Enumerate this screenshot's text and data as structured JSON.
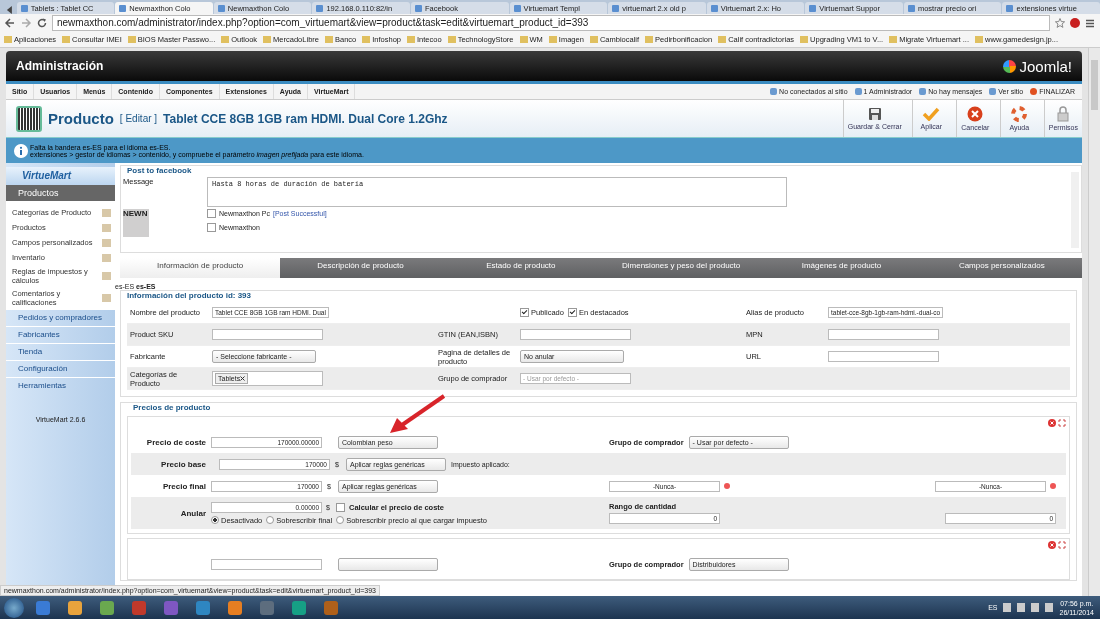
{
  "browser": {
    "tabs": [
      {
        "title": "Tablets : Tablet CC",
        "selected": false
      },
      {
        "title": "Newmaxthon Colo",
        "selected": true
      },
      {
        "title": "Newmaxthon Colo",
        "selected": false
      },
      {
        "title": "192.168.0.110:82/in",
        "selected": false
      },
      {
        "title": "Facebook",
        "selected": false
      },
      {
        "title": "Virtuemart Templ",
        "selected": false
      },
      {
        "title": "virtuemart 2.x old p",
        "selected": false
      },
      {
        "title": "Virtuemart 2.x: Ho",
        "selected": false
      },
      {
        "title": "Virtuemart Suppor",
        "selected": false
      },
      {
        "title": "mostrar precio ori",
        "selected": false
      },
      {
        "title": "extensiones virtue",
        "selected": false
      }
    ],
    "url": "newmaxthon.com/administrator/index.php?option=com_virtuemart&view=product&task=edit&virtuemart_product_id=393",
    "bookmarks": [
      "Aplicaciones",
      "Consultar IMEI",
      "BIOS Master Passwo...",
      "Outlook",
      "MercadoLibre",
      "Banco",
      "Infoshop",
      "Intecoo",
      "TechnologyStore",
      "WM",
      "Imagen",
      "Cambiocalif",
      "Pedirbonificacion",
      "Calif contradictorias",
      "Upgrading VM1 to V...",
      "Migrate Virtuemart ...",
      "www.gamedesign.jp..."
    ]
  },
  "header": {
    "title": "Administración",
    "logo": "Joomla!"
  },
  "menu": {
    "items": [
      "Sitio",
      "Usuarios",
      "Menús",
      "Contenido",
      "Componentes",
      "Extensiones",
      "Ayuda",
      "VirtueMart"
    ],
    "status": [
      "No conectados al sitio",
      "1 Administrador",
      "No hay mensajes",
      "Ver sitio",
      "FINALIZAR"
    ]
  },
  "toolbar": {
    "title": "Producto",
    "edit": "[ Editar ]",
    "product": "Tablet CCE 8GB 1GB ram HDMI. Dual Core 1.2Ghz",
    "buttons": [
      {
        "label": "Guardar & Cerrar",
        "kind": "save"
      },
      {
        "label": "Aplicar",
        "kind": "apply"
      },
      {
        "label": "Cancelar",
        "kind": "cancel"
      },
      {
        "label": "Ayuda",
        "kind": "help"
      },
      {
        "label": "Permisos",
        "kind": "lock"
      }
    ]
  },
  "message": [
    "Falta la bandera es-ES para el idioma es-ES.",
    "extensiones > gestor de idiomas > contenido, y compruebe el parámetro *imagen prefijada* para este idioma."
  ],
  "sidebar": {
    "logo": "VirtueMart",
    "section": "Productos",
    "items": [
      "Categorías de Producto",
      "Productos",
      "Campos personalizados",
      "Inventario",
      "Reglas de impuestos y cálculos",
      "Comentarios y calificaciones"
    ],
    "groups": [
      "Pedidos y compradores",
      "Fabricantes",
      "Tienda",
      "Configuración",
      "Herramientas"
    ],
    "version": "VirtueMart 2.6.6"
  },
  "facebook": {
    "legend": "Post to facebook",
    "label": "Message",
    "message": "Hasta 8 horas de duración de batería",
    "thumb": "NEWN",
    "pages": [
      {
        "name": "Newmaxthon Pc",
        "status": "[Post Successful]",
        "checked": false
      },
      {
        "name": "Newmaxthon",
        "checked": false
      }
    ]
  },
  "tabs": [
    {
      "label": "Información de producto",
      "selected": true
    },
    {
      "label": "Descripción de producto",
      "selected": false
    },
    {
      "label": "Estado de producto",
      "selected": false
    },
    {
      "label": "Dimensiones y peso del producto",
      "selected": false
    },
    {
      "label": "Imágenes de producto",
      "selected": false
    },
    {
      "label": "Campos personalizados",
      "selected": false
    }
  ],
  "language": "es-ES **es-ES**",
  "product_info": {
    "legend": "Información del producto id: 393",
    "rows": [
      [
        {
          "label": "Nombre del producto",
          "kind": "input",
          "value": "Tablet CCE 8GB 1GB ram HDMI. Dual"
        },
        {
          "kind": "checks",
          "checks": [
            {
              "label": "Publicado",
              "checked": true
            },
            {
              "label": "En destacados",
              "checked": true
            }
          ]
        },
        {
          "label": "Alias de producto",
          "kind": "input",
          "value": "tablet-cce-8gb-1gb-ram-hdmi.-dual-co"
        }
      ],
      [
        {
          "label": "Product SKU",
          "kind": "input"
        },
        {
          "label": "GTIN (EAN,ISBN)",
          "kind": "input"
        },
        {
          "label": "MPN",
          "kind": "input"
        }
      ],
      [
        {
          "label": "Fabricante",
          "kind": "select",
          "value": "- Seleccione fabricante -"
        },
        {
          "label": "Pagina de detalles de producto",
          "kind": "select",
          "value": "No anular"
        },
        {
          "label": "URL",
          "kind": "input"
        }
      ],
      [
        {
          "label": "Categorías de Producto",
          "kind": "tags",
          "tags": [
            "Tablets"
          ]
        },
        {
          "label": "Grupo de comprador",
          "kind": "input",
          "placeholder": "- Usar por defecto -"
        }
      ]
    ]
  },
  "prices": {
    "legend": "Precios de producto",
    "cost": {
      "label": "Precio de coste",
      "value": "170000.00000",
      "currency": "Colombian peso"
    },
    "base": {
      "label": "Precio base",
      "value": "170000",
      "symbol": "$",
      "rule": "Aplicar reglas genéricas",
      "tax": "Impuesto aplicado:"
    },
    "final": {
      "label": "Precio final",
      "value": "170000",
      "symbol": "$",
      "rule": "Aplicar reglas genéricas"
    },
    "override": {
      "label": "Anular",
      "value": "0.00000",
      "symbol": "$",
      "calc": {
        "label": "Calcular el precio de coste",
        "checked": false
      },
      "options": [
        {
          "label": "Desactivado",
          "selected": true
        },
        {
          "label": "Sobrescribir final",
          "selected": false
        },
        {
          "label": "Sobrescribir precio al que cargar impuesto",
          "selected": false
        }
      ]
    },
    "group_label": "Grupo de comprador",
    "group": "- Usar por defecto -",
    "dates": [
      "-Nunca-",
      "-Nunca-"
    ],
    "qty_label": "Rango de cantidad",
    "qty": [
      "0",
      "0"
    ],
    "next_group_label": "Grupo de comprador",
    "next_group": "Distribuidores"
  },
  "status_url": "newmaxthon.com/administrator/index.php?option=com_virtuemart&view=product&task=edit&virtuemart_product_id=393",
  "taskbar": {
    "language": "ES",
    "time": "07:56 p.m.",
    "date": "26/11/2014"
  }
}
